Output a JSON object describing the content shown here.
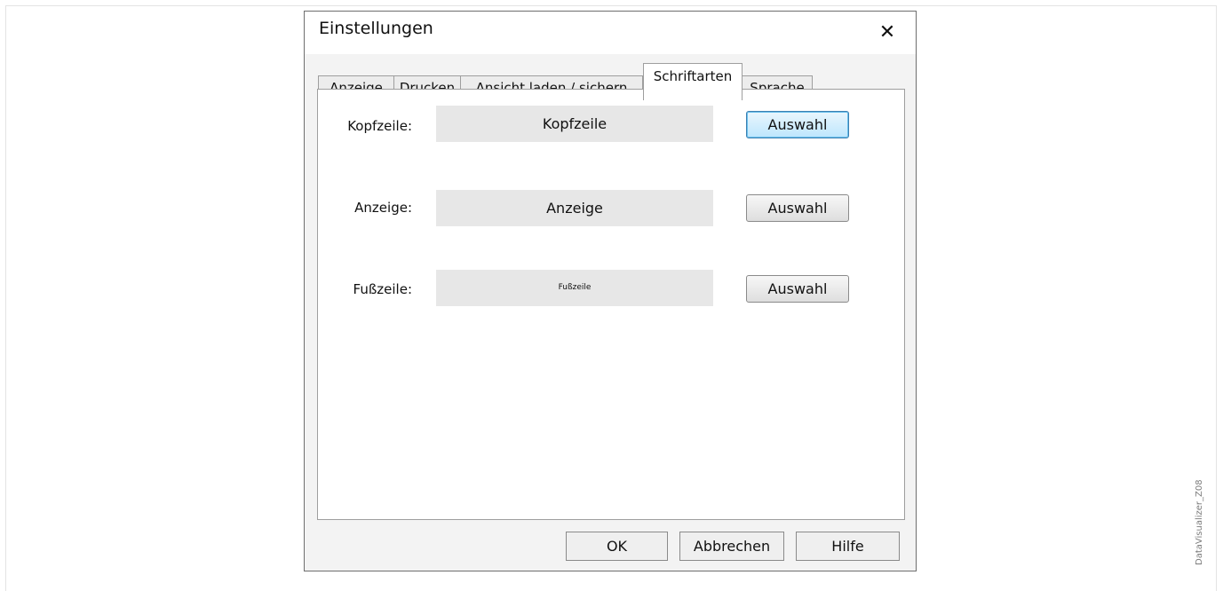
{
  "dialog": {
    "title": "Einstellungen",
    "close_icon": "close-icon",
    "close_glyph": "✕"
  },
  "tabs": [
    {
      "label": "Anzeige"
    },
    {
      "label": "Drucken"
    },
    {
      "label": "Ansicht laden / sichern"
    },
    {
      "label": "Schriftarten",
      "active": true
    },
    {
      "label": "Sprache"
    }
  ],
  "fonts": {
    "header": {
      "label": "Kopfzeile:",
      "preview": "Kopfzeile",
      "button": "Auswahl"
    },
    "display": {
      "label": "Anzeige:",
      "preview": "Anzeige",
      "button": "Auswahl"
    },
    "footer": {
      "label": "Fußzeile:",
      "preview": "Fußzeile",
      "button": "Auswahl"
    }
  },
  "footer": {
    "ok": "OK",
    "cancel": "Abbrechen",
    "help": "Hilfe"
  },
  "watermark": "DataVisualizer_Z08"
}
